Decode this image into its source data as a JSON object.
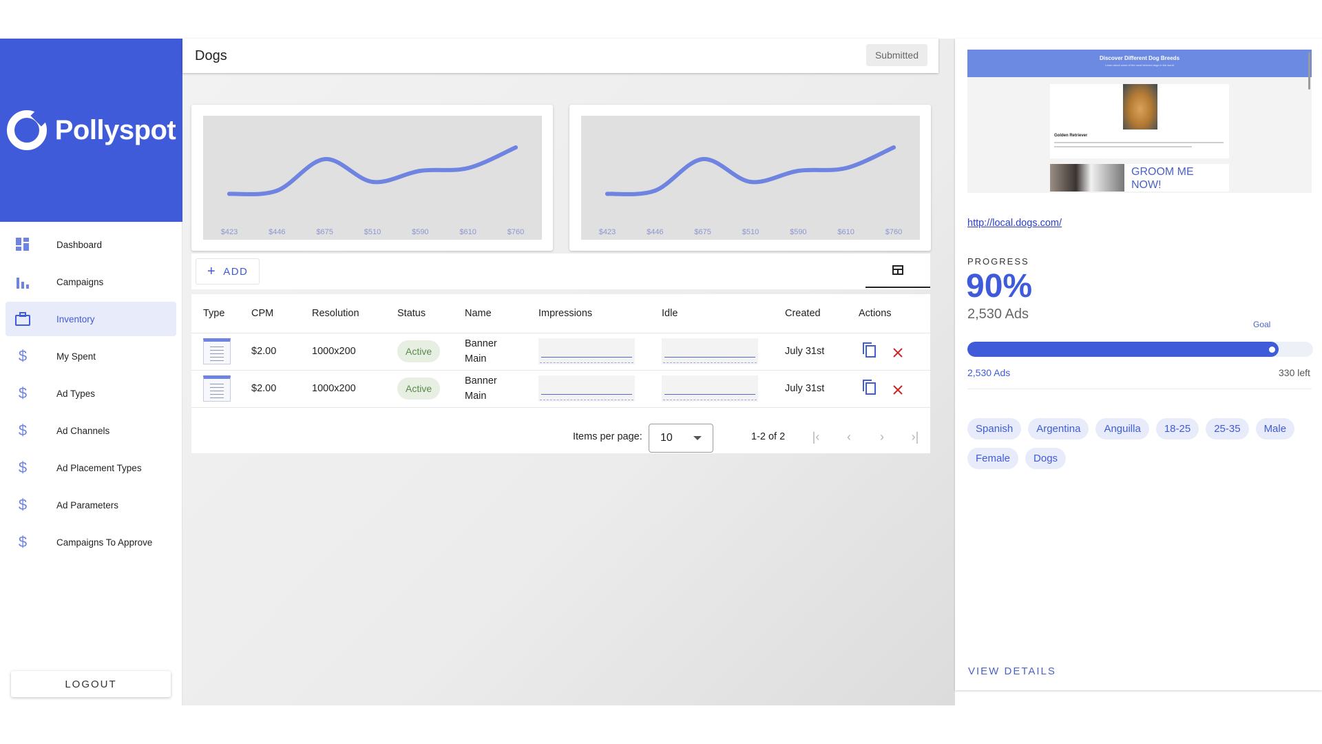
{
  "brand": {
    "name": "Pollyspot"
  },
  "sidebar": {
    "items": [
      {
        "label": "Dashboard",
        "icon": "dashboard-icon"
      },
      {
        "label": "Campaigns",
        "icon": "bar-chart-icon"
      },
      {
        "label": "Inventory",
        "icon": "briefcase-icon",
        "active": true
      },
      {
        "label": "My Spent",
        "icon": "dollar-icon"
      },
      {
        "label": "Ad Types",
        "icon": "dollar-icon"
      },
      {
        "label": "Ad Channels",
        "icon": "dollar-icon"
      },
      {
        "label": "Ad Placement Types",
        "icon": "dollar-icon"
      },
      {
        "label": "Ad Parameters",
        "icon": "dollar-icon"
      },
      {
        "label": "Campaigns To Approve",
        "icon": "dollar-icon"
      }
    ],
    "logout_label": "LOGOUT"
  },
  "header": {
    "title": "Dogs",
    "status": "Submitted"
  },
  "chart_data": [
    {
      "type": "line",
      "categories": [
        "$423",
        "$446",
        "$675",
        "$510",
        "$590",
        "$610",
        "$760"
      ],
      "values": [
        423,
        446,
        675,
        510,
        590,
        610,
        760
      ],
      "title": "",
      "xlabel": "",
      "ylabel": "",
      "grid": false,
      "color": "#6f84e0"
    },
    {
      "type": "line",
      "categories": [
        "$423",
        "$446",
        "$675",
        "$510",
        "$590",
        "$610",
        "$760"
      ],
      "values": [
        423,
        446,
        675,
        510,
        590,
        610,
        760
      ],
      "title": "",
      "xlabel": "",
      "ylabel": "",
      "grid": false,
      "color": "#6f84e0"
    }
  ],
  "toolbar": {
    "add_label": "ADD",
    "add_icon": "plus-icon",
    "grid_icon": "table-grid-icon"
  },
  "table": {
    "columns": [
      "Type",
      "CPM",
      "Resolution",
      "Status",
      "Name",
      "Impressions",
      "Idle",
      "Created",
      "Actions"
    ],
    "rows": [
      {
        "cpm": "$2.00",
        "resolution": "1000x200",
        "status": "Active",
        "name_line1": "Banner",
        "name_line2": "Main",
        "created": "July 31st"
      },
      {
        "cpm": "$2.00",
        "resolution": "1000x200",
        "status": "Active",
        "name_line1": "Banner",
        "name_line2": "Main",
        "created": "July 31st"
      }
    ]
  },
  "paginator": {
    "label": "Items per page:",
    "page_size": "10",
    "range": "1-2 of 2"
  },
  "panel": {
    "preview": {
      "heading": "Discover Different Dog Breeds",
      "subheading": "Learn about some of the most beloved dogs in the world",
      "breed": "Golden Retriever",
      "ad_text": "GROOM ME NOW!"
    },
    "url": "http://local.dogs.com/",
    "progress_label": "PROGRESS",
    "progress_value": "90%",
    "progress_fraction": 0.9,
    "ads_count": "2,530 Ads",
    "goal_label": "Goal",
    "bar_left": "2,530 Ads",
    "bar_right": "330 left",
    "chips": [
      "Spanish",
      "Argentina",
      "Anguilla",
      "18-25",
      "25-35",
      "Male",
      "Female",
      "Dogs"
    ],
    "view_details": "VIEW DETAILS"
  },
  "colors": {
    "accent": "#3f5bd9",
    "line": "#6f84e0",
    "danger": "#c62828",
    "success": "#5a8a4a"
  }
}
